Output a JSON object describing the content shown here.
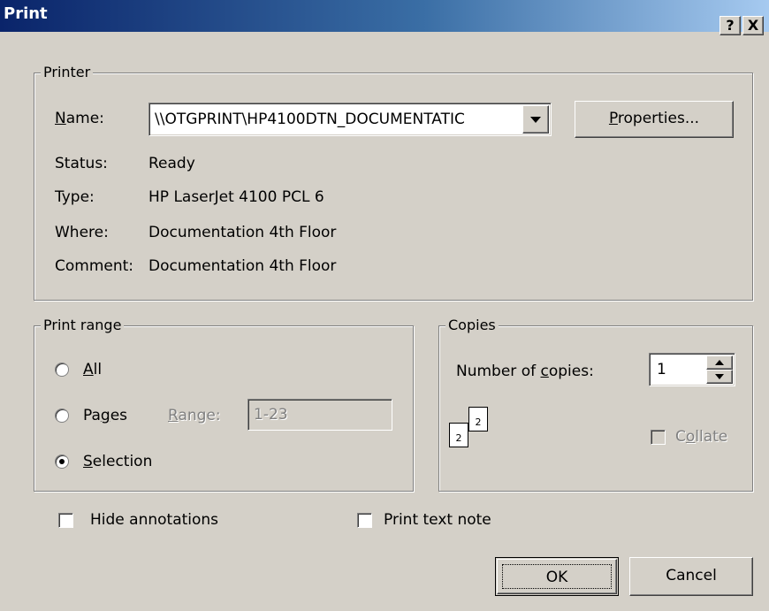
{
  "window": {
    "title": "Print",
    "help_label": "?",
    "close_label": "X"
  },
  "printer": {
    "group_label": "Printer",
    "name_label": "Name:",
    "name_value": "\\\\OTGPRINT\\HP4100DTN_DOCUMENTATIC",
    "properties_label": "Properties...",
    "status_label": "Status:",
    "status_value": "Ready",
    "type_label": "Type:",
    "type_value": "HP LaserJet 4100 PCL 6",
    "where_label": "Where:",
    "where_value": "Documentation 4th Floor",
    "comment_label": "Comment:",
    "comment_value": "Documentation 4th Floor"
  },
  "print_range": {
    "group_label": "Print range",
    "all_label": "All",
    "pages_label": "Pages",
    "range_label": "Range:",
    "range_value": "1-23",
    "selection_label": "Selection",
    "selected": "Selection"
  },
  "copies": {
    "group_label": "Copies",
    "number_label": "Number of copies:",
    "number_value": "1",
    "collate_label": "Collate",
    "collate_checked": false,
    "collate_icon_pages": [
      "2",
      "2"
    ]
  },
  "options": {
    "hide_annotations_label": "Hide annotations",
    "hide_annotations_checked": false,
    "print_text_note_label": "Print text note",
    "print_text_note_checked": false
  },
  "buttons": {
    "ok_label": "OK",
    "cancel_label": "Cancel"
  }
}
